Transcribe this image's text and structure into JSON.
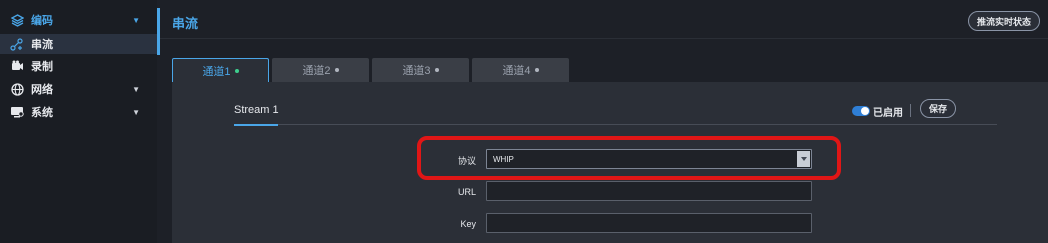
{
  "sidebar": {
    "items": [
      {
        "label": "编码",
        "icon": "layers-icon"
      },
      {
        "label": "串流",
        "icon": "stream-icon"
      },
      {
        "label": "录制",
        "icon": "camera-icon"
      },
      {
        "label": "网络",
        "icon": "globe-icon"
      },
      {
        "label": "系统",
        "icon": "system-icon"
      }
    ]
  },
  "header": {
    "title": "串流",
    "status_button": "推流实时状态"
  },
  "tabs": [
    {
      "label": "通道1"
    },
    {
      "label": "通道2"
    },
    {
      "label": "通道3"
    },
    {
      "label": "通道4"
    }
  ],
  "panel": {
    "stream_title": "Stream 1",
    "enabled_label": "已启用",
    "save_label": "保存",
    "enabled": true
  },
  "form": {
    "protocol_label": "协议",
    "protocol_value": "WHIP",
    "url_label": "URL",
    "url_value": "",
    "key_label": "Key",
    "key_value": ""
  },
  "colors": {
    "accent": "#4aa6e8",
    "highlight": "#e01616",
    "active_dot": "#3ecf8e"
  }
}
